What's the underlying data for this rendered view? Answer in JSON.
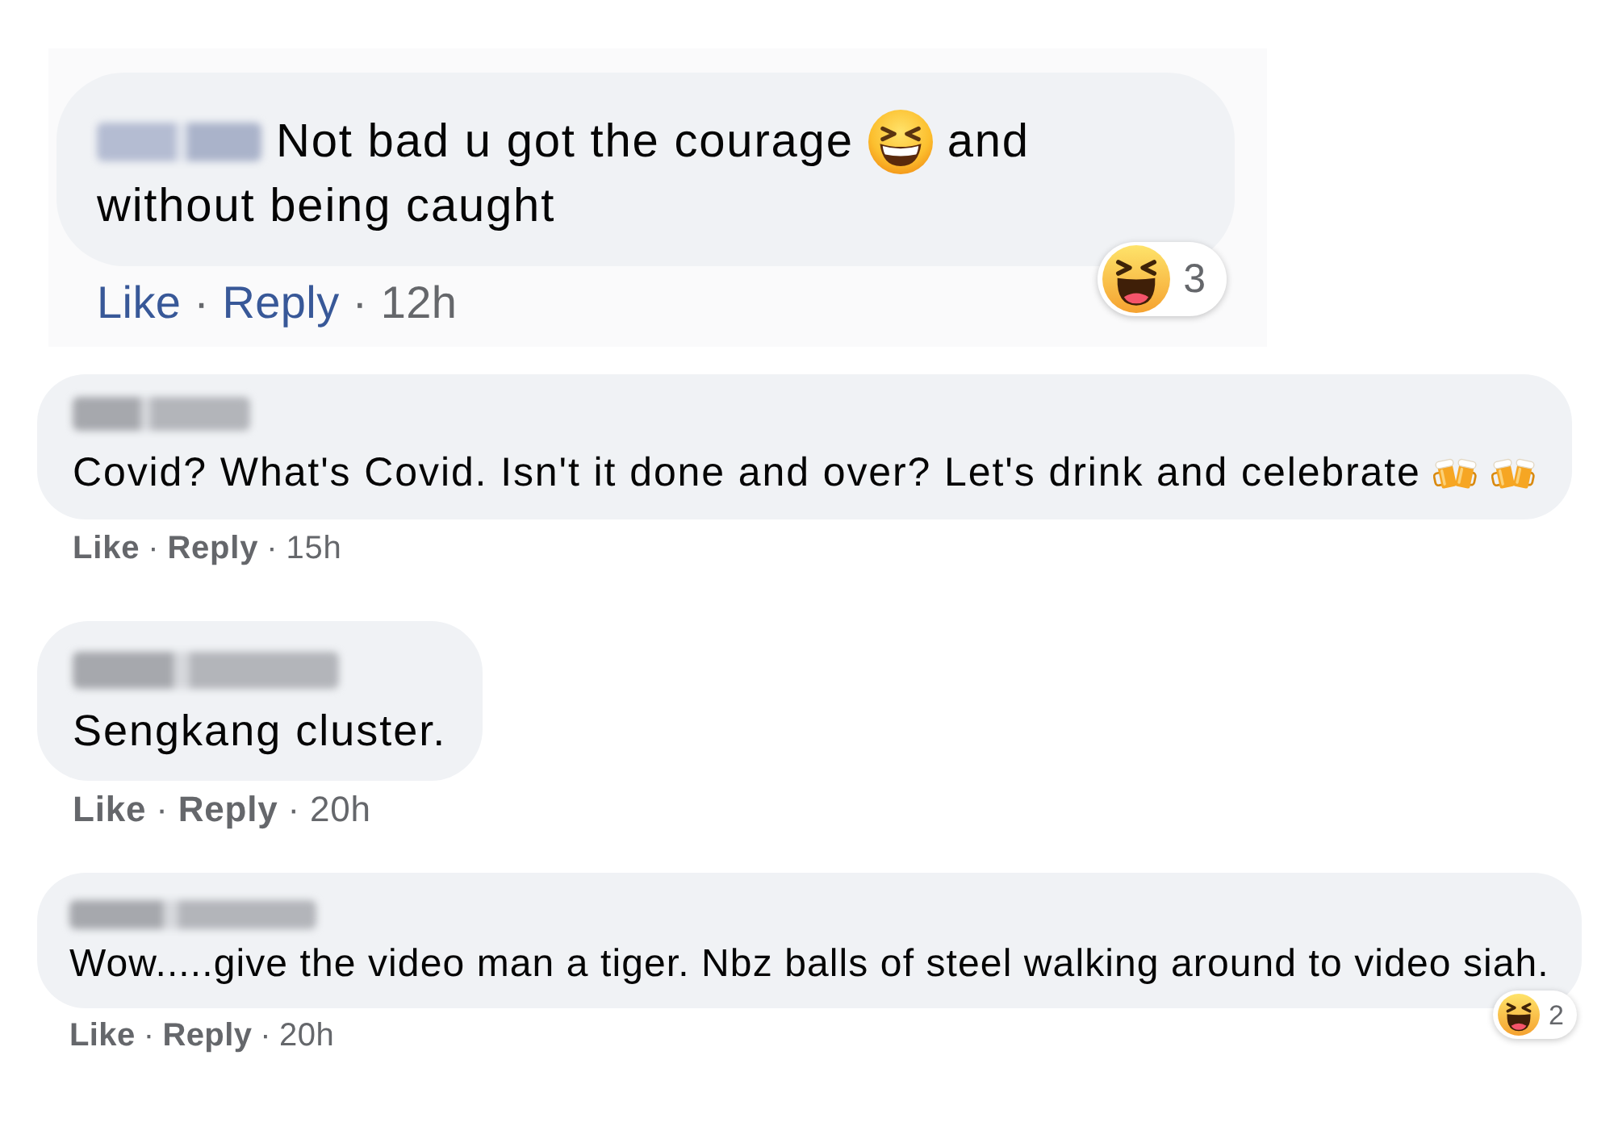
{
  "comments": [
    {
      "kind": "highlighted",
      "author": {
        "blurred": true
      },
      "body": [
        {
          "kind": "text",
          "text": "Not bad u got the courage"
        },
        {
          "kind": "grin"
        },
        {
          "kind": "text",
          "text": "and"
        },
        {
          "kind": "text",
          "text": "without being caught"
        }
      ],
      "reactions": {
        "count": "3"
      },
      "actions": [
        {
          "kind": "link",
          "text": "Like"
        },
        {
          "kind": "dot",
          "text": "·"
        },
        {
          "kind": "link",
          "text": "Reply"
        },
        {
          "kind": "dot",
          "text": "·"
        },
        {
          "kind": "time",
          "text": "12h"
        }
      ]
    },
    {
      "kind": "plain",
      "author": {
        "blurred": true
      },
      "body": [
        {
          "kind": "text",
          "text": "Covid? What's Covid. Isn't it done and over? Let's drink and celebrate"
        },
        {
          "kind": "cheers"
        },
        {
          "kind": "cheers"
        }
      ],
      "actions": [
        {
          "kind": "link",
          "text": "Like"
        },
        {
          "kind": "dot",
          "text": "·"
        },
        {
          "kind": "link",
          "text": "Reply"
        },
        {
          "kind": "dot",
          "text": "·"
        },
        {
          "kind": "time",
          "text": "15h"
        }
      ]
    },
    {
      "kind": "plain",
      "author": {
        "blurred": true
      },
      "body": [
        {
          "kind": "text",
          "text": "Sengkang cluster."
        }
      ],
      "actions": [
        {
          "kind": "link",
          "text": "Like"
        },
        {
          "kind": "dot",
          "text": "·"
        },
        {
          "kind": "link",
          "text": "Reply"
        },
        {
          "kind": "dot",
          "text": "·"
        },
        {
          "kind": "time",
          "text": "20h"
        }
      ]
    },
    {
      "kind": "plain",
      "author": {
        "blurred": true
      },
      "body": [
        {
          "kind": "text",
          "text": "Wow.....give the video man a tiger. Nbz balls of steel walking around to video siah."
        }
      ],
      "reactions": {
        "count": "2"
      },
      "actions": [
        {
          "kind": "link",
          "text": "Like"
        },
        {
          "kind": "dot",
          "text": "·"
        },
        {
          "kind": "link",
          "text": "Reply"
        },
        {
          "kind": "dot",
          "text": "·"
        },
        {
          "kind": "time",
          "text": "20h"
        }
      ]
    }
  ]
}
